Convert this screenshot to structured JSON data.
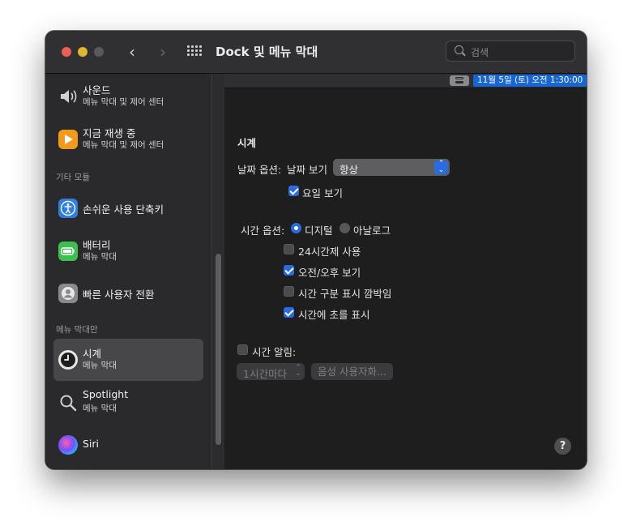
{
  "window": {
    "title": "Dock 및 메뉴 막대"
  },
  "search": {
    "placeholder": "검색"
  },
  "sidebar": {
    "items_top": [
      {
        "name": "사운드",
        "sub": "메뉴 막대 및 제어 센터",
        "icon": "speaker-icon"
      },
      {
        "name": "지금 재생 중",
        "sub": "메뉴 막대 및 제어 센터",
        "icon": "now-playing-icon"
      }
    ],
    "section_other": "기타 모듈",
    "items_other": [
      {
        "name": "손쉬운 사용 단축키",
        "icon": "accessibility-icon"
      },
      {
        "name": "배터리",
        "sub": "메뉴 막대",
        "icon": "battery-icon"
      },
      {
        "name": "빠른 사용자 전환",
        "icon": "user-switch-icon"
      }
    ],
    "section_menubar": "메뉴 막대만",
    "items_menubar": [
      {
        "name": "시계",
        "sub": "메뉴 막대",
        "icon": "clock-icon",
        "selected": true
      },
      {
        "name": "Spotlight",
        "sub": "메뉴 막대",
        "icon": "spotlight-icon"
      },
      {
        "name": "Siri",
        "icon": "siri-icon"
      }
    ]
  },
  "menubar_preview": {
    "clock": "11월 5일 (토) 오전  1:30:00"
  },
  "clock": {
    "heading": "시계",
    "date_options_label": "날짜 옵션:",
    "show_date_label": "날짜 보기",
    "show_date_value": "항상",
    "show_weekday_label": "요일 보기",
    "time_options_label": "시간 옵션:",
    "digital_label": "디지털",
    "analog_label": "아날로그",
    "h24_label": "24시간제 사용",
    "ampm_label": "오전/오후 보기",
    "flash_label": "시간 구분 표시 깜박임",
    "seconds_label": "시간에 초를 표시",
    "announce_label": "시간 알림:",
    "announce_interval": "1시간마다",
    "voice_button": "음성 사용자화..."
  },
  "colors": {
    "accent": "#2a6be0",
    "menubar_highlight": "#1766d6"
  }
}
